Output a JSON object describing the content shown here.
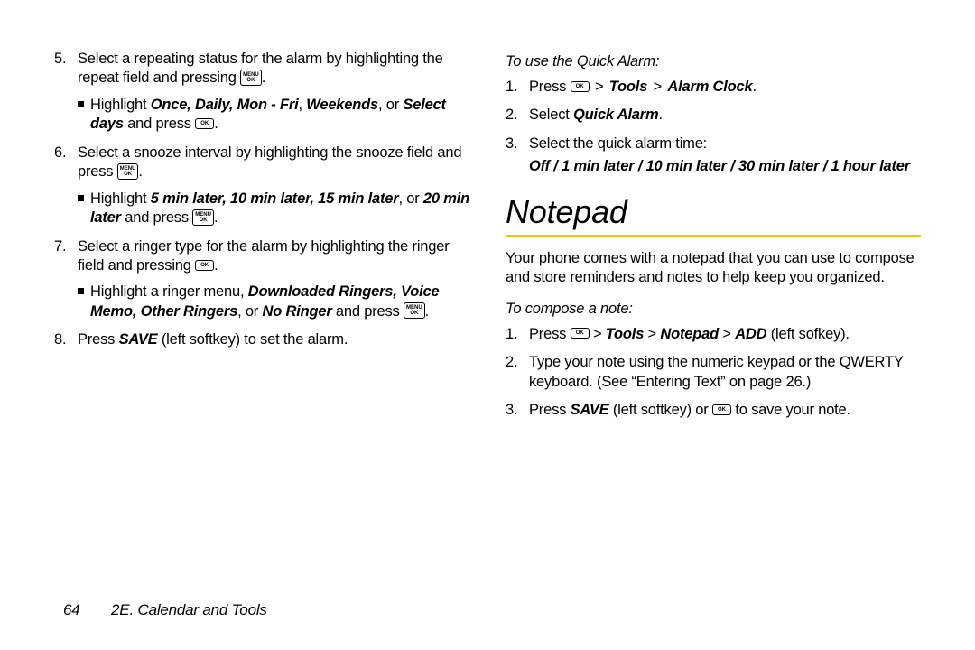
{
  "keys": {
    "menu_ok": "MENU\nOK",
    "ok": "OK"
  },
  "left": {
    "items": [
      {
        "num": "5.",
        "parts": [
          {
            "t": "Select a repeating status for the alarm by highlighting the repeat field and pressing "
          },
          {
            "key": "menu_ok"
          },
          {
            "t": "."
          }
        ],
        "sub": [
          {
            "parts": [
              {
                "t": "Highlight "
              },
              {
                "t": "Once, Daily, Mon - Fri",
                "cls": "boldital"
              },
              {
                "t": ", "
              },
              {
                "t": "Weekends",
                "cls": "boldital"
              },
              {
                "t": ", or "
              },
              {
                "t": "Select days",
                "cls": "boldital"
              },
              {
                "t": " and press "
              },
              {
                "key": "ok"
              },
              {
                "t": "."
              }
            ]
          }
        ]
      },
      {
        "num": "6.",
        "parts": [
          {
            "t": "Select a snooze interval by highlighting the snooze field and press "
          },
          {
            "key": "menu_ok"
          },
          {
            "t": "."
          }
        ],
        "sub": [
          {
            "parts": [
              {
                "t": "Highlight "
              },
              {
                "t": "5 min later, 10 min later, 15 min later",
                "cls": "boldital"
              },
              {
                "t": ", or "
              },
              {
                "t": "20 min later",
                "cls": "boldital"
              },
              {
                "t": " and press "
              },
              {
                "key": "menu_ok"
              },
              {
                "t": "."
              }
            ]
          }
        ]
      },
      {
        "num": "7.",
        "parts": [
          {
            "t": "Select a ringer type for the alarm by highlighting the ringer field and pressing "
          },
          {
            "key": "ok"
          },
          {
            "t": "."
          }
        ],
        "sub": [
          {
            "parts": [
              {
                "t": "Highlight a ringer menu, "
              },
              {
                "t": "Downloaded Ringers, Voice Memo, Other Ringers",
                "cls": "boldital"
              },
              {
                "t": ", or "
              },
              {
                "t": "No Ringer",
                "cls": "boldital"
              },
              {
                "t": " and press "
              },
              {
                "key": "menu_ok"
              },
              {
                "t": "."
              }
            ]
          }
        ]
      },
      {
        "num": "8.",
        "parts": [
          {
            "t": "Press "
          },
          {
            "t": "SAVE",
            "cls": "boldital"
          },
          {
            "t": " (left softkey) to set the alarm."
          }
        ]
      }
    ]
  },
  "right": {
    "quick_alarm_head": "To use the Quick Alarm:",
    "quick_alarm_items": [
      {
        "num": "1.",
        "parts": [
          {
            "t": "Press "
          },
          {
            "key": "ok"
          },
          {
            "t": " "
          },
          {
            "gt": ">"
          },
          {
            "t": " "
          },
          {
            "t": "Tools",
            "cls": "boldital"
          },
          {
            "t": " "
          },
          {
            "gt": ">"
          },
          {
            "t": " "
          },
          {
            "t": "Alarm Clock",
            "cls": "boldital"
          },
          {
            "t": "."
          }
        ]
      },
      {
        "num": "2.",
        "parts": [
          {
            "t": "Select "
          },
          {
            "t": "Quick Alarm",
            "cls": "boldital"
          },
          {
            "t": "."
          }
        ]
      },
      {
        "num": "3.",
        "parts": [
          {
            "t": "Select the quick alarm time:"
          }
        ],
        "extra": [
          {
            "t": "Off / 1 min later / 10 min later / 30 min later / 1 hour later",
            "cls": "boldital"
          }
        ]
      }
    ],
    "section_title": "Notepad",
    "intro": "Your phone comes with a notepad that you can use to compose and store reminders and notes to help keep you organized.",
    "compose_head": "To compose a note:",
    "compose_items": [
      {
        "num": "1.",
        "parts": [
          {
            "t": "Press "
          },
          {
            "key": "ok"
          },
          {
            "t": " > "
          },
          {
            "t": "Tools",
            "cls": "boldital"
          },
          {
            "t": " > "
          },
          {
            "t": "Notepad",
            "cls": "boldital"
          },
          {
            "t": " > "
          },
          {
            "t": "ADD",
            "cls": "boldital"
          },
          {
            "t": " (left sofkey)."
          }
        ]
      },
      {
        "num": "2.",
        "parts": [
          {
            "t": "Type your note using the numeric keypad or the QWERTY keyboard. (See “Entering Text” on page 26.)"
          }
        ]
      },
      {
        "num": "3.",
        "parts": [
          {
            "t": "Press "
          },
          {
            "t": "SAVE",
            "cls": "boldital"
          },
          {
            "t": " (left softkey) or "
          },
          {
            "key": "ok"
          },
          {
            "t": " to save your note."
          }
        ]
      }
    ]
  },
  "footer": {
    "page": "64",
    "section": "2E. Calendar and Tools"
  }
}
